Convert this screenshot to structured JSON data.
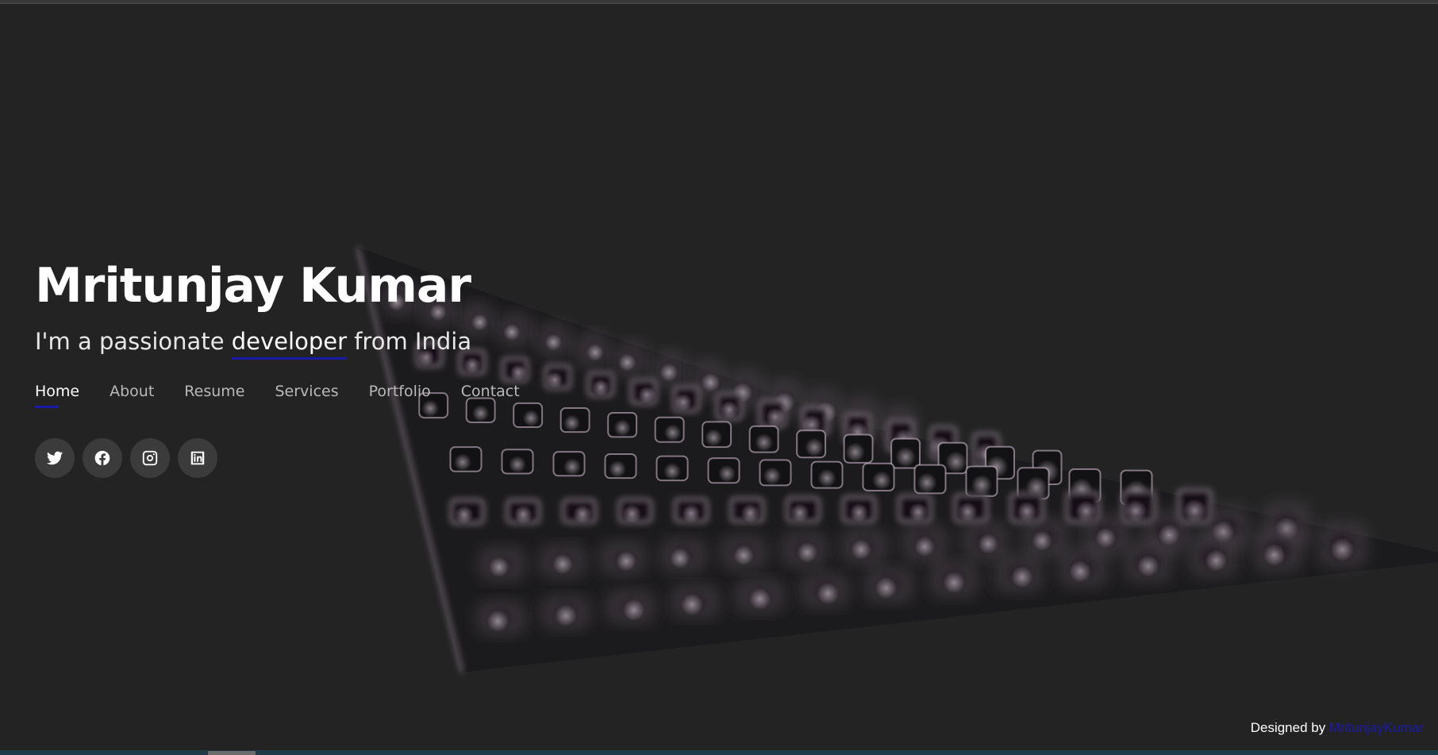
{
  "hero": {
    "name": "Mritunjay Kumar",
    "tagline_prefix": "I'm a passionate ",
    "tagline_highlight": "developer",
    "tagline_suffix": " from India"
  },
  "nav": {
    "items": [
      {
        "label": "Home",
        "active": true
      },
      {
        "label": "About",
        "active": false
      },
      {
        "label": "Resume",
        "active": false
      },
      {
        "label": "Services",
        "active": false
      },
      {
        "label": "Portfolio",
        "active": false
      },
      {
        "label": "Contact",
        "active": false
      }
    ]
  },
  "social": {
    "icons": [
      "twitter-icon",
      "facebook-icon",
      "instagram-icon",
      "linkedin-icon"
    ]
  },
  "footer": {
    "credits_prefix": "Designed by ",
    "credits_link": "MritunjayKumar"
  },
  "colors": {
    "background": "#232323",
    "accent": "#1a1aa8",
    "text": "#ffffff"
  }
}
